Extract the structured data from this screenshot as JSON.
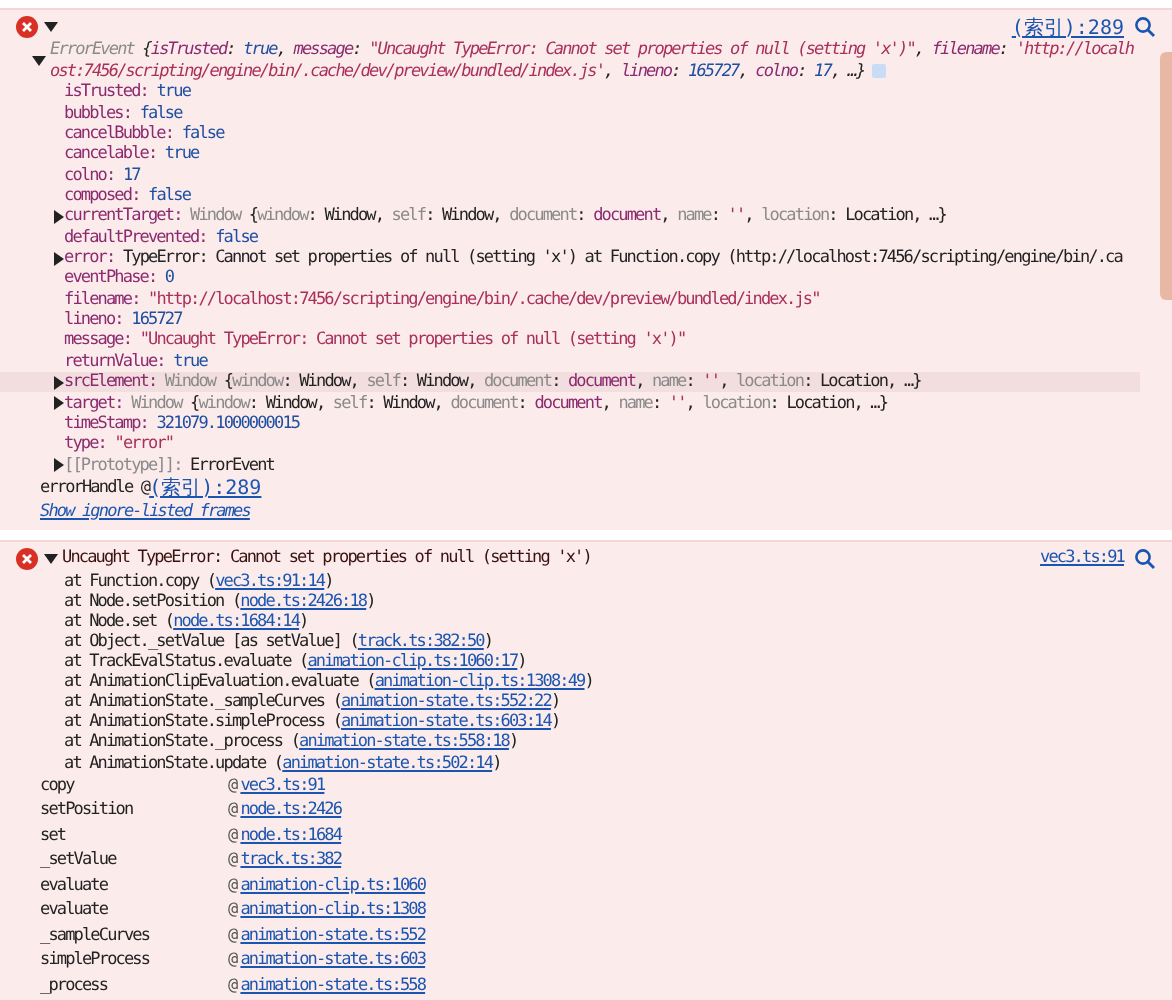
{
  "event_message": {
    "expanded": true,
    "source_link": "(索引):289",
    "summary": {
      "expanded": true,
      "parts": [
        {
          "text": "ErrorEvent ",
          "kind": "dim"
        },
        {
          "text": "{",
          "kind": "plain"
        },
        {
          "text": "isTrusted",
          "kind": "key"
        },
        {
          "text": ": ",
          "kind": "plain"
        },
        {
          "text": "true",
          "kind": "literal"
        },
        {
          "text": ", ",
          "kind": "plain"
        },
        {
          "text": "message",
          "kind": "key"
        },
        {
          "text": ": ",
          "kind": "plain"
        },
        {
          "text": "\"Uncaught TypeError: Cannot set properties of null (setting 'x')\"",
          "kind": "string"
        },
        {
          "text": ", ",
          "kind": "plain"
        },
        {
          "text": "filename",
          "kind": "key"
        },
        {
          "text": ": ",
          "kind": "plain"
        },
        {
          "text": "'http://localhost:7456/scripting/engine/bin/.cache/dev/preview/bundled/index.js'",
          "kind": "string"
        },
        {
          "text": ", ",
          "kind": "plain"
        },
        {
          "text": "lineno",
          "kind": "key"
        },
        {
          "text": ": ",
          "kind": "plain"
        },
        {
          "text": "165727",
          "kind": "literal"
        },
        {
          "text": ", ",
          "kind": "plain"
        },
        {
          "text": "colno",
          "kind": "key"
        },
        {
          "text": ": ",
          "kind": "plain"
        },
        {
          "text": "17",
          "kind": "literal"
        },
        {
          "text": ", …}",
          "kind": "plain"
        }
      ]
    },
    "properties": [
      {
        "kind": "leaf",
        "name": "isTrusted:",
        "highlighted": false,
        "value": [
          {
            "text": "true",
            "kind": "literal"
          }
        ]
      },
      {
        "kind": "leaf",
        "name": "bubbles:",
        "highlighted": false,
        "value": [
          {
            "text": "false",
            "kind": "literal"
          }
        ]
      },
      {
        "kind": "leaf",
        "name": "cancelBubble:",
        "highlighted": false,
        "value": [
          {
            "text": "false",
            "kind": "literal"
          }
        ]
      },
      {
        "kind": "leaf",
        "name": "cancelable:",
        "highlighted": false,
        "value": [
          {
            "text": "true",
            "kind": "literal"
          }
        ]
      },
      {
        "kind": "leaf",
        "name": "colno:",
        "highlighted": false,
        "value": [
          {
            "text": "17",
            "kind": "literal"
          }
        ]
      },
      {
        "kind": "leaf",
        "name": "composed:",
        "highlighted": false,
        "value": [
          {
            "text": "false",
            "kind": "literal"
          }
        ]
      },
      {
        "kind": "object",
        "expanded": false,
        "name": "currentTarget:",
        "highlighted": false,
        "value": [
          {
            "text": "Window ",
            "kind": "dim"
          },
          {
            "text": "{",
            "kind": "plain"
          },
          {
            "text": "window",
            "kind": "dim"
          },
          {
            "text": ": Window, ",
            "kind": "plain"
          },
          {
            "text": "self",
            "kind": "dim"
          },
          {
            "text": ": Window, ",
            "kind": "plain"
          },
          {
            "text": "document",
            "kind": "dim"
          },
          {
            "text": ": ",
            "kind": "plain"
          },
          {
            "text": "document",
            "kind": "key"
          },
          {
            "text": ", ",
            "kind": "plain"
          },
          {
            "text": "name",
            "kind": "dim"
          },
          {
            "text": ": ",
            "kind": "plain"
          },
          {
            "text": "''",
            "kind": "string"
          },
          {
            "text": ", ",
            "kind": "plain"
          },
          {
            "text": "location",
            "kind": "dim"
          },
          {
            "text": ": Location, …}",
            "kind": "plain"
          }
        ]
      },
      {
        "kind": "leaf",
        "name": "defaultPrevented:",
        "highlighted": false,
        "value": [
          {
            "text": "false",
            "kind": "literal"
          }
        ]
      },
      {
        "kind": "object",
        "expanded": false,
        "name": "error:",
        "highlighted": false,
        "value": [
          {
            "text": "TypeError: Cannot set properties of null (setting 'x') at Function.copy (http://localhost:7456/scripting/engine/bin/.ca",
            "kind": "plain"
          }
        ]
      },
      {
        "kind": "leaf",
        "name": "eventPhase:",
        "highlighted": false,
        "value": [
          {
            "text": "0",
            "kind": "literal"
          }
        ]
      },
      {
        "kind": "leaf",
        "name": "filename:",
        "highlighted": false,
        "value": [
          {
            "text": "\"http://localhost:7456/scripting/engine/bin/.cache/dev/preview/bundled/index.js\"",
            "kind": "string"
          }
        ]
      },
      {
        "kind": "leaf",
        "name": "lineno:",
        "highlighted": false,
        "value": [
          {
            "text": "165727",
            "kind": "literal"
          }
        ]
      },
      {
        "kind": "leaf",
        "name": "message:",
        "highlighted": false,
        "value": [
          {
            "text": "\"Uncaught TypeError: Cannot set properties of null (setting 'x')\"",
            "kind": "string"
          }
        ]
      },
      {
        "kind": "leaf",
        "name": "returnValue:",
        "highlighted": false,
        "value": [
          {
            "text": "true",
            "kind": "literal"
          }
        ]
      },
      {
        "kind": "object",
        "expanded": false,
        "name": "srcElement:",
        "highlighted": true,
        "value": [
          {
            "text": "Window ",
            "kind": "dim"
          },
          {
            "text": "{",
            "kind": "plain"
          },
          {
            "text": "window",
            "kind": "dim"
          },
          {
            "text": ": Window, ",
            "kind": "plain"
          },
          {
            "text": "self",
            "kind": "dim"
          },
          {
            "text": ": Window, ",
            "kind": "plain"
          },
          {
            "text": "document",
            "kind": "dim"
          },
          {
            "text": ": ",
            "kind": "plain"
          },
          {
            "text": "document",
            "kind": "key"
          },
          {
            "text": ", ",
            "kind": "plain"
          },
          {
            "text": "name",
            "kind": "dim"
          },
          {
            "text": ": ",
            "kind": "plain"
          },
          {
            "text": "''",
            "kind": "string"
          },
          {
            "text": ", ",
            "kind": "plain"
          },
          {
            "text": "location",
            "kind": "dim"
          },
          {
            "text": ": Location, …}",
            "kind": "plain"
          }
        ]
      },
      {
        "kind": "object",
        "expanded": false,
        "name": "target:",
        "highlighted": false,
        "value": [
          {
            "text": "Window ",
            "kind": "dim"
          },
          {
            "text": "{",
            "kind": "plain"
          },
          {
            "text": "window",
            "kind": "dim"
          },
          {
            "text": ": Window, ",
            "kind": "plain"
          },
          {
            "text": "self",
            "kind": "dim"
          },
          {
            "text": ": Window, ",
            "kind": "plain"
          },
          {
            "text": "document",
            "kind": "dim"
          },
          {
            "text": ": ",
            "kind": "plain"
          },
          {
            "text": "document",
            "kind": "key"
          },
          {
            "text": ", ",
            "kind": "plain"
          },
          {
            "text": "name",
            "kind": "dim"
          },
          {
            "text": ": ",
            "kind": "plain"
          },
          {
            "text": "''",
            "kind": "string"
          },
          {
            "text": ", ",
            "kind": "plain"
          },
          {
            "text": "location",
            "kind": "dim"
          },
          {
            "text": ": Location, …}",
            "kind": "plain"
          }
        ]
      },
      {
        "kind": "leaf",
        "name": "timeStamp:",
        "highlighted": false,
        "value": [
          {
            "text": "321079.1000000015",
            "kind": "literal"
          }
        ]
      },
      {
        "kind": "leaf",
        "name": "type:",
        "highlighted": false,
        "value": [
          {
            "text": "\"error\"",
            "kind": "string"
          }
        ]
      },
      {
        "kind": "internal",
        "expanded": false,
        "name": "[[Prototype]]:",
        "highlighted": false,
        "value": [
          {
            "text": "ErrorEvent",
            "kind": "plain"
          }
        ]
      }
    ],
    "handler": {
      "text": "errorHandle @ ",
      "link": "(索引):289"
    },
    "ignore_link": "Show ignore-listed frames"
  },
  "error_message": {
    "expanded": true,
    "message": "Uncaught TypeError: Cannot set properties of null (setting 'x')",
    "source_link": "vec3.ts:91",
    "frames": [
      {
        "call": "at Function.copy (",
        "link": "vec3.ts:91:14",
        "close": ")"
      },
      {
        "call": "at Node.setPosition (",
        "link": "node.ts:2426:18",
        "close": ")"
      },
      {
        "call": "at Node.set (",
        "link": "node.ts:1684:14",
        "close": ")"
      },
      {
        "call": "at Object._setValue [as setValue] (",
        "link": "track.ts:382:50",
        "close": ")"
      },
      {
        "call": "at TrackEvalStatus.evaluate (",
        "link": "animation-clip.ts:1060:17",
        "close": ")"
      },
      {
        "call": "at AnimationClipEvaluation.evaluate (",
        "link": "animation-clip.ts:1308:49",
        "close": ")"
      },
      {
        "call": "at AnimationState._sampleCurves (",
        "link": "animation-state.ts:552:22",
        "close": ")"
      },
      {
        "call": "at AnimationState.simpleProcess (",
        "link": "animation-state.ts:603:14",
        "close": ")"
      },
      {
        "call": "at AnimationState._process (",
        "link": "animation-state.ts:558:18",
        "close": ")"
      },
      {
        "call": "at AnimationState.update (",
        "link": "animation-state.ts:502:14",
        "close": ")"
      }
    ],
    "call_stack": [
      {
        "function": "copy",
        "at": "@",
        "link": "vec3.ts:91"
      },
      {
        "function": "setPosition",
        "at": "@",
        "link": "node.ts:2426"
      },
      {
        "function": "set",
        "at": "@",
        "link": "node.ts:1684"
      },
      {
        "function": "_setValue",
        "at": "@",
        "link": "track.ts:382"
      },
      {
        "function": "evaluate",
        "at": "@",
        "link": "animation-clip.ts:1060"
      },
      {
        "function": "evaluate",
        "at": "@",
        "link": "animation-clip.ts:1308"
      },
      {
        "function": "_sampleCurves",
        "at": "@",
        "link": "animation-state.ts:552"
      },
      {
        "function": "simpleProcess",
        "at": "@",
        "link": "animation-state.ts:603"
      },
      {
        "function": "_process",
        "at": "@",
        "link": "animation-state.ts:558"
      }
    ]
  }
}
